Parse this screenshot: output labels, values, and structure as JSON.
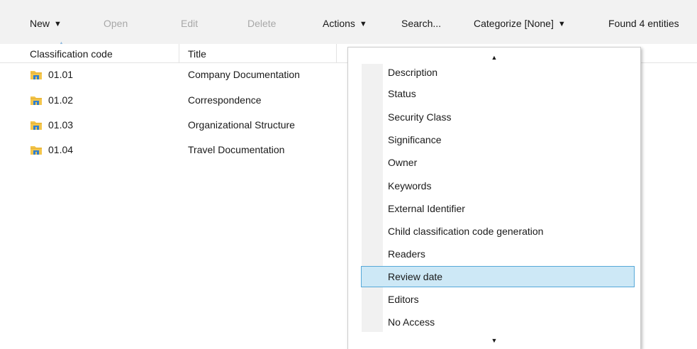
{
  "toolbar": {
    "new": "New",
    "open": "Open",
    "edit": "Edit",
    "delete": "Delete",
    "actions": "Actions",
    "search": "Search...",
    "categorize": "Categorize [None]",
    "found": "Found 4 entities"
  },
  "columns": {
    "code": "Classification code",
    "title": "Title"
  },
  "rows": [
    {
      "code": "01.01",
      "title": "Company Documentation",
      "icon": "folder-icon"
    },
    {
      "code": "01.02",
      "title": "Correspondence",
      "icon": "folder-icon"
    },
    {
      "code": "01.03",
      "title": "Organizational Structure",
      "icon": "folder-icon"
    },
    {
      "code": "01.04",
      "title": "Travel Documentation",
      "icon": "folder-icon"
    }
  ],
  "menu": {
    "items": [
      "Description",
      "Status",
      "Security Class",
      "Significance",
      "Owner",
      "Keywords",
      "External Identifier",
      "Child classification code generation",
      "Readers",
      "Review date",
      "Editors",
      "No Access"
    ],
    "highlighted": "Review date"
  },
  "colors": {
    "toolbar_bg": "#f2f2f2",
    "disabled_text": "#a8a8a8",
    "highlight_bg": "#cde8f6",
    "highlight_border": "#56a8d8",
    "folder_yellow": "#f4c64c",
    "folder_blue": "#2f7fd0"
  }
}
